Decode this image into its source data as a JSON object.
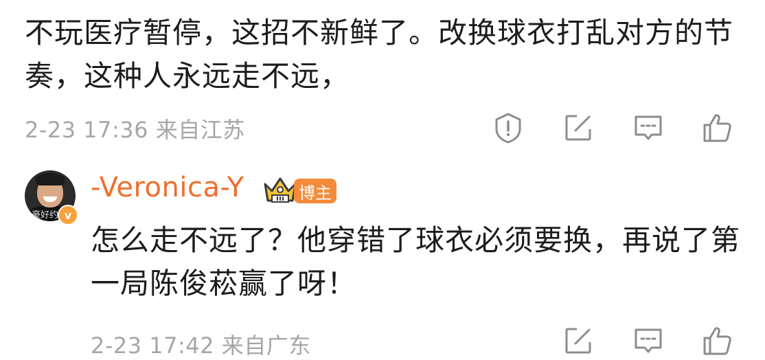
{
  "comment1": {
    "text": "不玩医疗暂停，这招不新鲜了。改换球衣打乱对方的节奏，这种人永远走不远，",
    "time": "2-23 17:36",
    "location": "来自江苏"
  },
  "reply": {
    "username": "-Veronica-Y",
    "badge_label": "博主",
    "verified_mark": "v",
    "avatar_watermark": "豪好约",
    "text": "怎么走不远了？他穿错了球衣必须要换，再说了第一局陈俊菘赢了呀！",
    "time": "2-23 17:42",
    "location": "来自广东"
  },
  "icons": [
    "report-icon",
    "share-icon",
    "comment-icon",
    "like-icon"
  ],
  "colors": {
    "text": "#1c1c1c",
    "meta": "#a6a6a6",
    "username": "#f06e2a",
    "badge": "#f38b3a",
    "icon": "#8c8c8c"
  }
}
